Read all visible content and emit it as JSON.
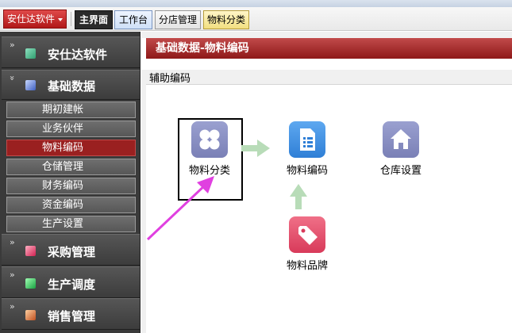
{
  "tabs": {
    "app_menu": "安仕达软件",
    "items": [
      "主界面",
      "工作台",
      "分店管理",
      "物料分类"
    ]
  },
  "sidebar": {
    "sections": [
      {
        "label": "安仕达软件",
        "icon": "app-icon",
        "color": "#3fbf8f"
      },
      {
        "label": "基础数据",
        "icon": "basic-data-icon",
        "color": "#5a7fd6"
      },
      {
        "label": "采购管理",
        "icon": "purchase-icon",
        "color": "#e0406a"
      },
      {
        "label": "生产调度",
        "icon": "production-icon",
        "color": "#2fc45a"
      },
      {
        "label": "销售管理",
        "icon": "sales-icon",
        "color": "#e07840"
      }
    ],
    "sub_items": [
      "期初建帐",
      "业务伙伴",
      "物料编码",
      "仓储管理",
      "财务编码",
      "资金编码",
      "生产设置"
    ],
    "active_sub": "物料编码"
  },
  "main": {
    "banner": "基础数据-物料编码",
    "subtitle": "辅助编码",
    "nodes": [
      {
        "label": "物料分类",
        "icon": "four-petal-icon",
        "color": "#8a8fc0"
      },
      {
        "label": "物料编码",
        "icon": "document-list-icon",
        "color": "#3d8fe0"
      },
      {
        "label": "仓库设置",
        "icon": "house-icon",
        "color": "#8a8fc0"
      },
      {
        "label": "物料品牌",
        "icon": "tag-icon",
        "color": "#e0506a"
      }
    ]
  },
  "colors": {
    "accent_red": "#9a2020",
    "arrow_green": "#b8dcb8",
    "pointer_magenta": "#e040e0"
  }
}
